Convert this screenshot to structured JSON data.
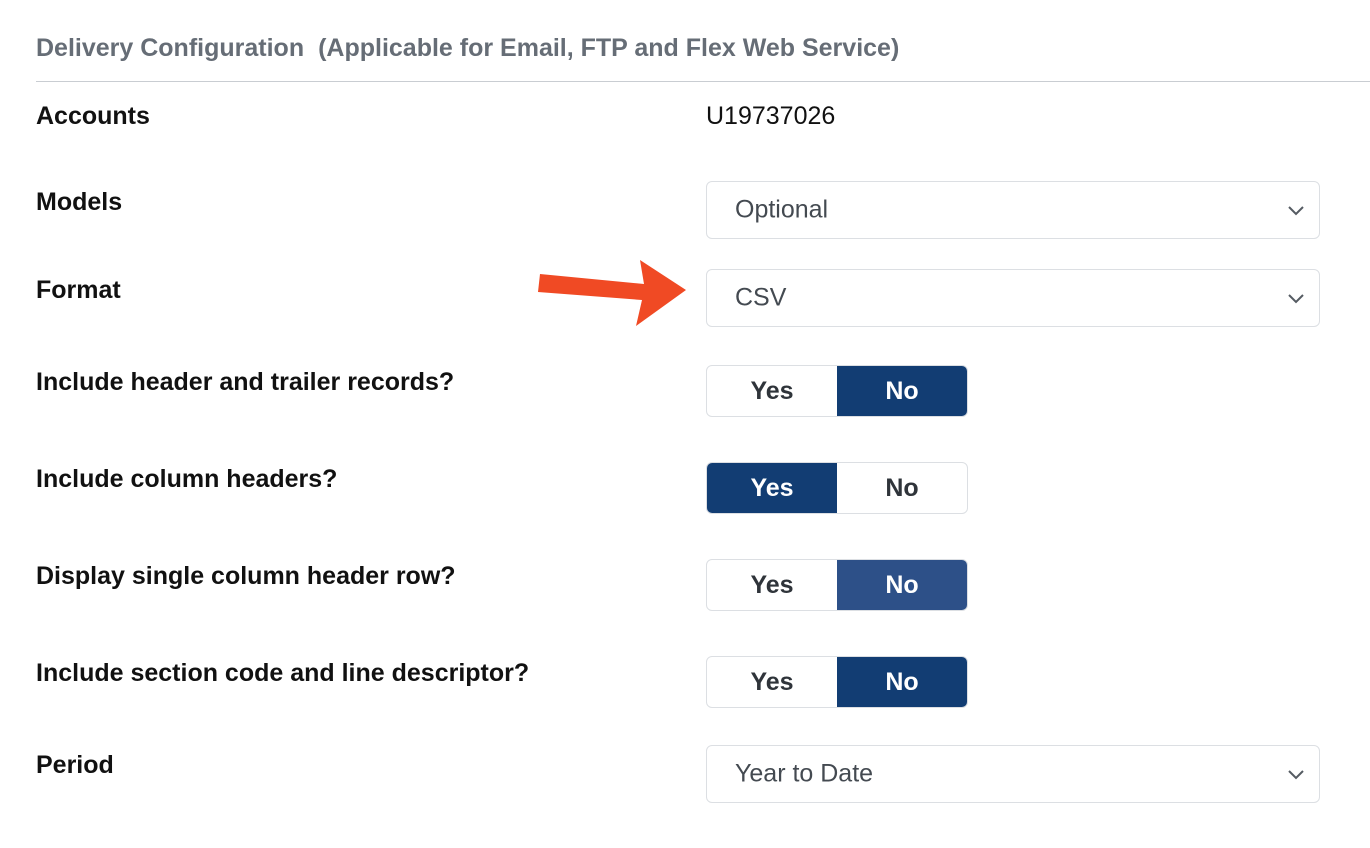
{
  "header": {
    "title": "Delivery Configuration",
    "subtitle": "(Applicable for Email, FTP and Flex Web Service)"
  },
  "accounts": {
    "label": "Accounts",
    "value": "U19737026"
  },
  "models": {
    "label": "Models",
    "value": "Optional"
  },
  "format": {
    "label": "Format",
    "value": "CSV"
  },
  "header_trailer": {
    "label": "Include header and trailer records?",
    "yes": "Yes",
    "no": "No",
    "selected": "No"
  },
  "column_headers": {
    "label": "Include column headers?",
    "yes": "Yes",
    "no": "No",
    "selected": "Yes"
  },
  "single_header_row": {
    "label": "Display single column header row?",
    "yes": "Yes",
    "no": "No",
    "selected": "No"
  },
  "section_code": {
    "label": "Include section code and line descriptor?",
    "yes": "Yes",
    "no": "No",
    "selected": "No"
  },
  "period": {
    "label": "Period",
    "value": "Year to Date"
  },
  "colors": {
    "accent": "#123d73",
    "accent_light": "#2d5088",
    "annotation_arrow": "#f04a24",
    "header_text": "#666d76"
  }
}
